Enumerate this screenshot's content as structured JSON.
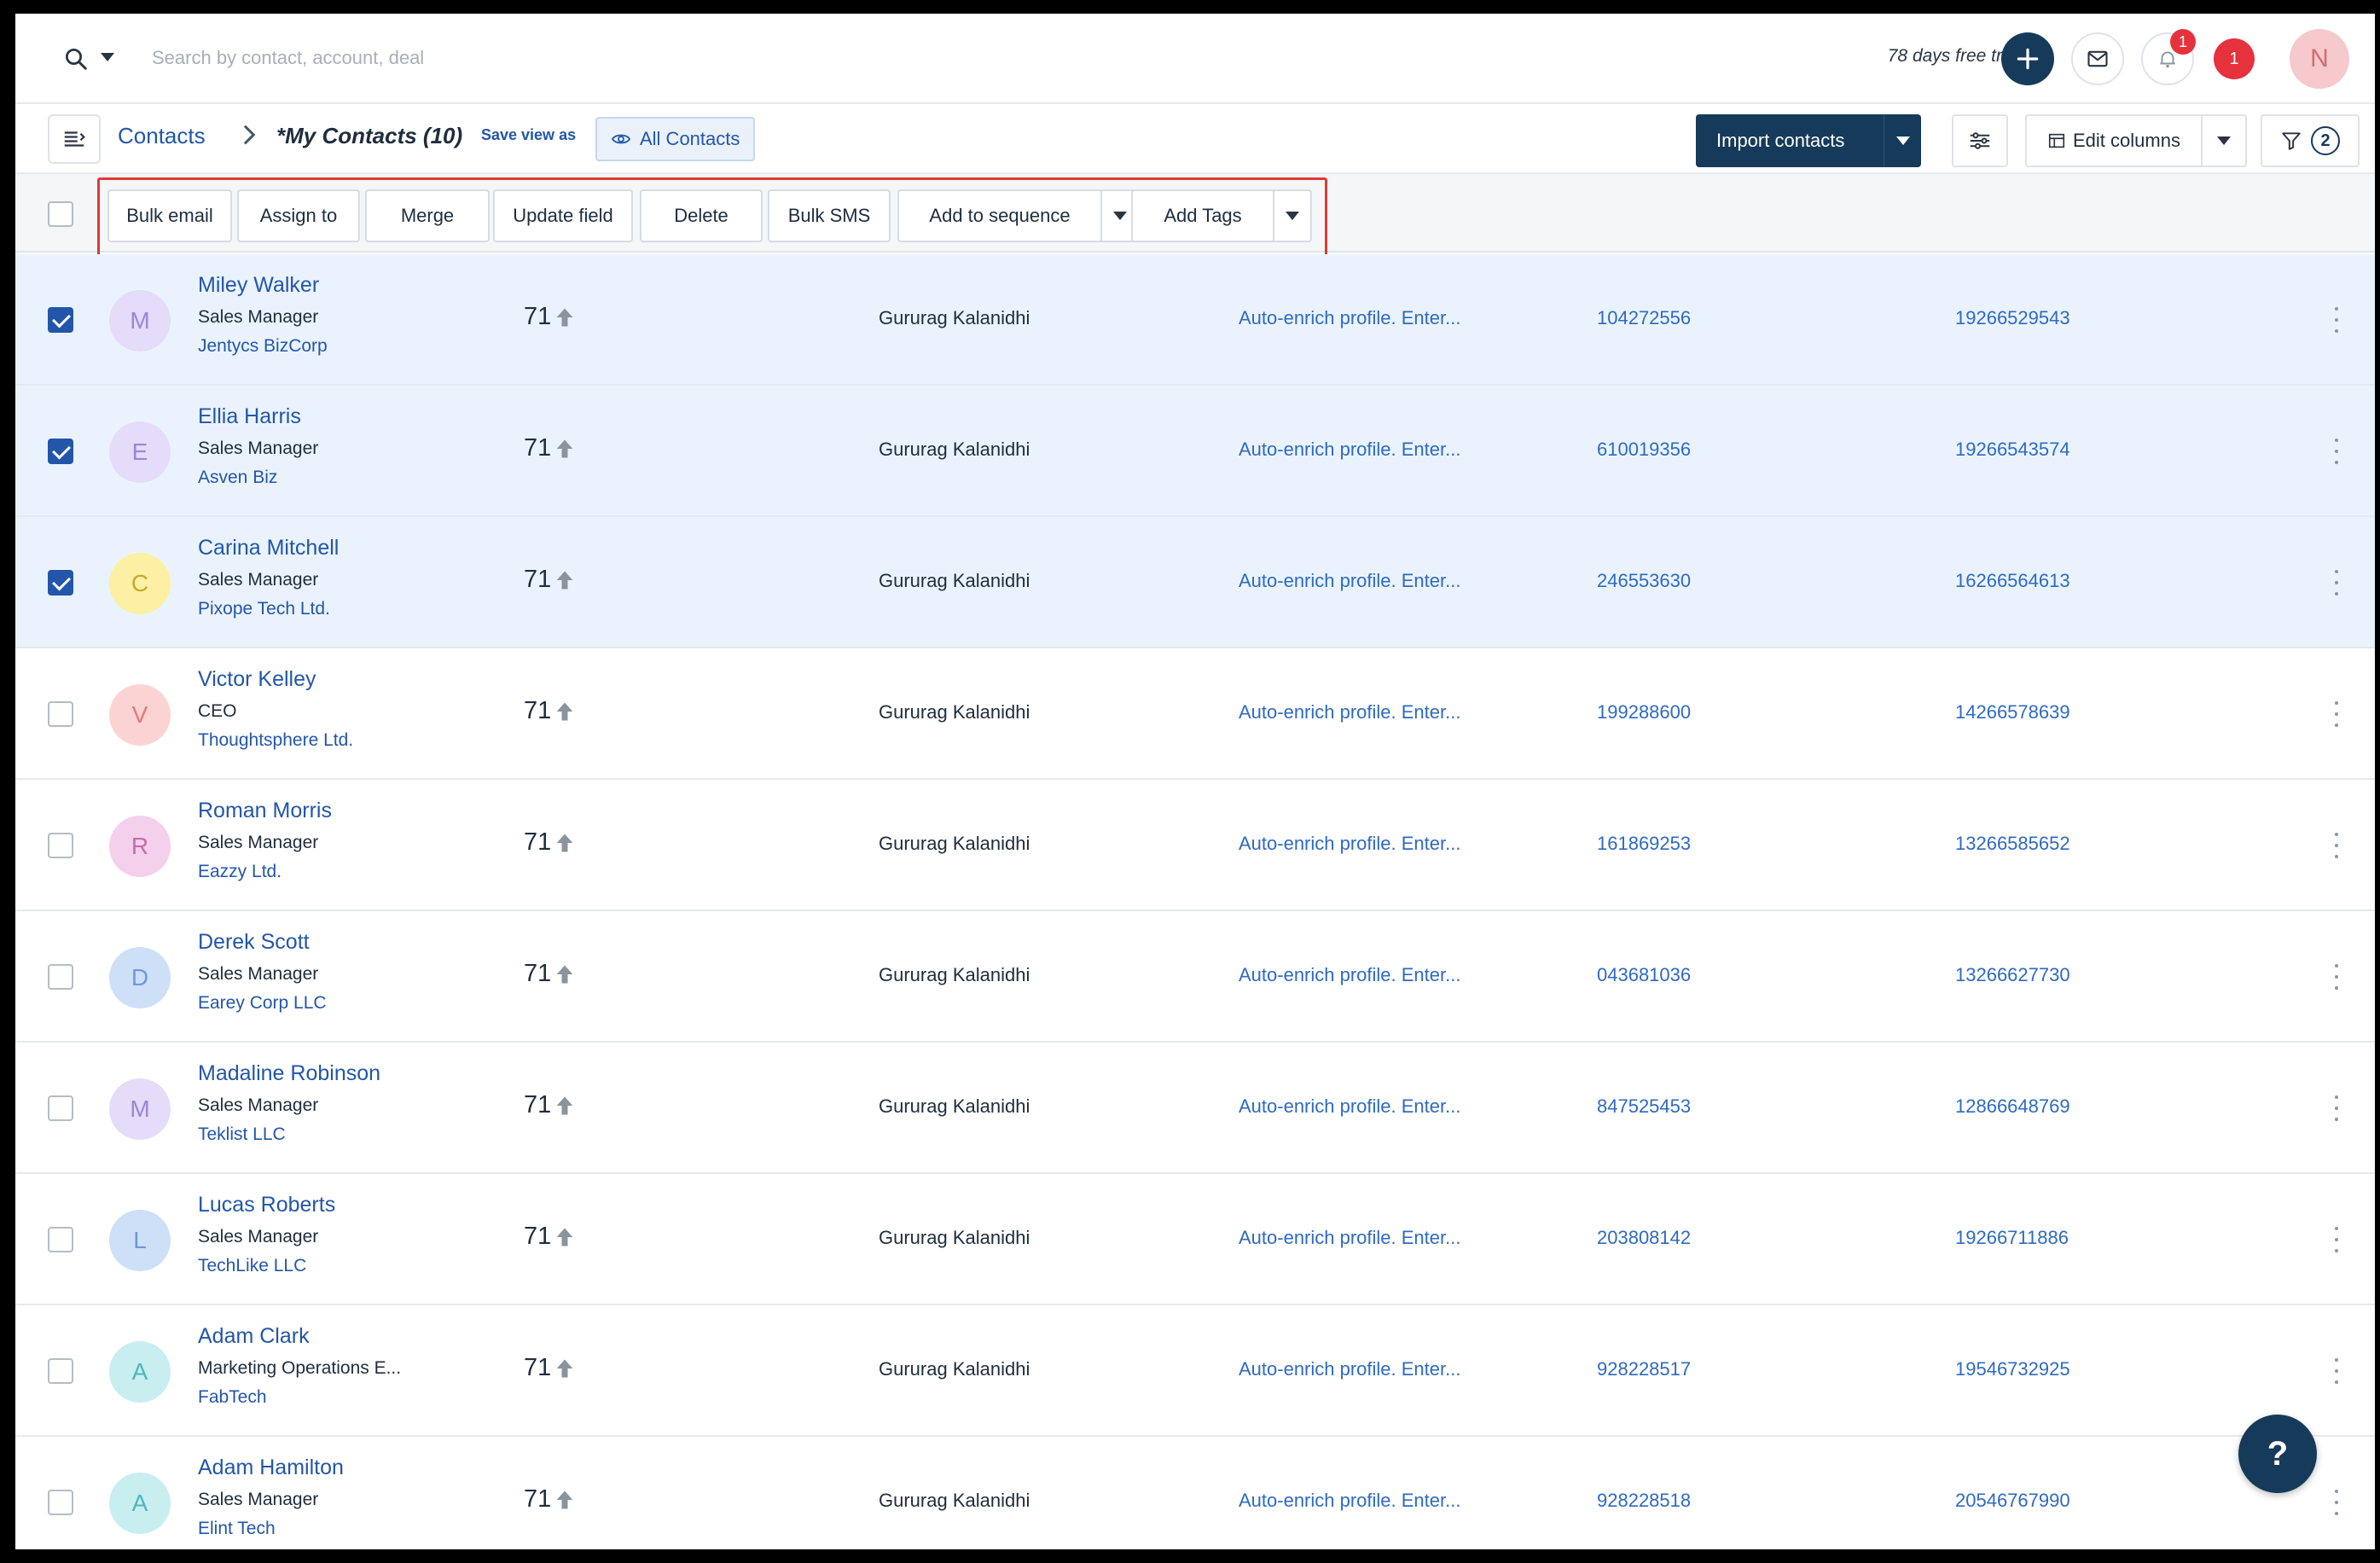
{
  "search": {
    "placeholder": "Search by contact, account, deal"
  },
  "topbar": {
    "trial_text": "78 days free trial",
    "bell_badge": "1",
    "notifications_badge": "1",
    "user_initial": "N"
  },
  "header": {
    "breadcrumb_root": "Contacts",
    "current_view": "*My Contacts (10)",
    "save_view_as": "Save view as",
    "all_contacts": "All Contacts",
    "import_contacts": "Import contacts",
    "edit_columns": "Edit columns",
    "filter_count": "2"
  },
  "bulk_actions": {
    "bulk_email": "Bulk email",
    "assign_to": "Assign to",
    "merge": "Merge",
    "update_field": "Update field",
    "delete": "Delete",
    "bulk_sms": "Bulk SMS",
    "add_to_sequence": "Add to sequence",
    "add_tags": "Add Tags"
  },
  "contacts": [
    {
      "initial": "M",
      "name": "Miley Walker",
      "title": "Sales Manager",
      "company": "Jentycs BizCorp",
      "score": "71",
      "owner": "Gururag Kalanidhi",
      "enrich": "Auto-enrich profile. Enter...",
      "phone1": "104272556",
      "phone2": "19266529543",
      "selected": true,
      "avatar_bg": "#e4dcf8",
      "avatar_fg": "#9b86d6"
    },
    {
      "initial": "E",
      "name": "Ellia Harris",
      "title": "Sales Manager",
      "company": "Asven Biz",
      "score": "71",
      "owner": "Gururag Kalanidhi",
      "enrich": "Auto-enrich profile. Enter...",
      "phone1": "610019356",
      "phone2": "19266543574",
      "selected": true,
      "avatar_bg": "#e4dcf8",
      "avatar_fg": "#9b86d6"
    },
    {
      "initial": "C",
      "name": "Carina Mitchell",
      "title": "Sales Manager",
      "company": "Pixope Tech Ltd.",
      "score": "71",
      "owner": "Gururag Kalanidhi",
      "enrich": "Auto-enrich profile. Enter...",
      "phone1": "246553630",
      "phone2": "16266564613",
      "selected": true,
      "avatar_bg": "#fbf0a4",
      "avatar_fg": "#c7a82a"
    },
    {
      "initial": "V",
      "name": "Victor Kelley",
      "title": "CEO",
      "company": "Thoughtsphere Ltd.",
      "score": "71",
      "owner": "Gururag Kalanidhi",
      "enrich": "Auto-enrich profile. Enter...",
      "phone1": "199288600",
      "phone2": "14266578639",
      "selected": false,
      "avatar_bg": "#fcd3d3",
      "avatar_fg": "#e07a7a"
    },
    {
      "initial": "R",
      "name": "Roman Morris",
      "title": "Sales Manager",
      "company": "Eazzy Ltd.",
      "score": "71",
      "owner": "Gururag Kalanidhi",
      "enrich": "Auto-enrich profile. Enter...",
      "phone1": "161869253",
      "phone2": "13266585652",
      "selected": false,
      "avatar_bg": "#f4d0ec",
      "avatar_fg": "#c66aae"
    },
    {
      "initial": "D",
      "name": "Derek Scott",
      "title": "Sales Manager",
      "company": "Earey Corp LLC",
      "score": "71",
      "owner": "Gururag Kalanidhi",
      "enrich": "Auto-enrich profile. Enter...",
      "phone1": "043681036",
      "phone2": "13266627730",
      "selected": false,
      "avatar_bg": "#cde0f8",
      "avatar_fg": "#6f99d6"
    },
    {
      "initial": "M",
      "name": "Madaline Robinson",
      "title": "Sales Manager",
      "company": "Teklist LLC",
      "score": "71",
      "owner": "Gururag Kalanidhi",
      "enrich": "Auto-enrich profile. Enter...",
      "phone1": "847525453",
      "phone2": "12866648769",
      "selected": false,
      "avatar_bg": "#e4dcf8",
      "avatar_fg": "#9b86d6"
    },
    {
      "initial": "L",
      "name": "Lucas Roberts",
      "title": "Sales Manager",
      "company": "TechLike LLC",
      "score": "71",
      "owner": "Gururag Kalanidhi",
      "enrich": "Auto-enrich profile. Enter...",
      "phone1": "203808142",
      "phone2": "19266711886",
      "selected": false,
      "avatar_bg": "#cde0f8",
      "avatar_fg": "#6f99d6"
    },
    {
      "initial": "A",
      "name": "Adam Clark",
      "title": "Marketing Operations E...",
      "company": "FabTech",
      "score": "71",
      "owner": "Gururag Kalanidhi",
      "enrich": "Auto-enrich profile. Enter...",
      "phone1": "928228517",
      "phone2": "19546732925",
      "selected": false,
      "avatar_bg": "#c8eef0",
      "avatar_fg": "#4fb6bd"
    },
    {
      "initial": "A",
      "name": "Adam Hamilton",
      "title": "Sales Manager",
      "company": "Elint Tech",
      "score": "71",
      "owner": "Gururag Kalanidhi",
      "enrich": "Auto-enrich profile. Enter...",
      "phone1": "928228518",
      "phone2": "20546767990",
      "selected": false,
      "avatar_bg": "#c8eef0",
      "avatar_fg": "#4fb6bd"
    }
  ],
  "help": {
    "label": "?"
  },
  "colors": {
    "accent": "#163a5a",
    "link": "#2356a8",
    "highlight": "#de3a36",
    "selected_row": "#eaf3fd"
  }
}
